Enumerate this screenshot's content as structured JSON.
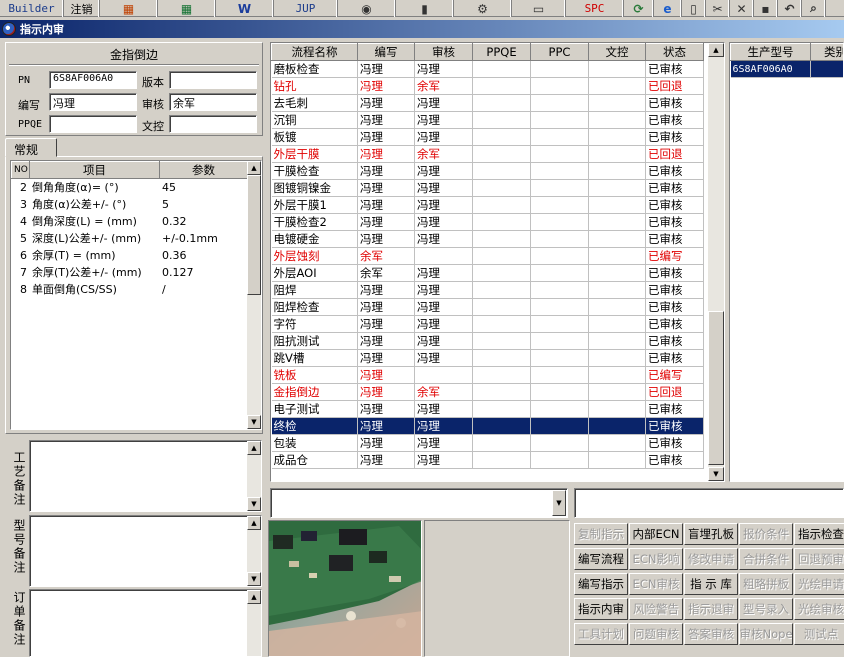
{
  "toolbar": {
    "items": [
      {
        "label": "Builder",
        "icon": ""
      },
      {
        "label": "注销",
        "icon": ""
      },
      {
        "label": "",
        "icon": "x-icon"
      },
      {
        "label": "",
        "icon": "excel-icon"
      },
      {
        "label": "",
        "icon": "word-icon"
      },
      {
        "label": "JUP",
        "icon": ""
      },
      {
        "label": "",
        "icon": "eye-icon"
      },
      {
        "label": "",
        "icon": "database-icon"
      },
      {
        "label": "",
        "icon": "network-icon"
      },
      {
        "label": "",
        "icon": "computer-icon"
      },
      {
        "label": "SPC",
        "icon": ""
      },
      {
        "label": "",
        "icon": "refresh-icon"
      },
      {
        "label": "",
        "icon": "ie-icon"
      },
      {
        "label": "",
        "icon": "new-icon"
      },
      {
        "label": "",
        "icon": "scissors-icon"
      },
      {
        "label": "",
        "icon": "close-icon"
      },
      {
        "label": "",
        "icon": "save-icon"
      },
      {
        "label": "",
        "icon": "undo-icon"
      },
      {
        "label": "",
        "icon": "search-icon"
      }
    ]
  },
  "window": {
    "title": "指示内审"
  },
  "info": {
    "group_title": "金指倒边",
    "pn_label": "PN",
    "pn_value": "6S8AF006A0",
    "version_label": "版本",
    "version_value": "",
    "author_label": "编写",
    "author_value": "冯理",
    "reviewer_label": "审核",
    "reviewer_value": "余军",
    "ppqe_label": "PPQE",
    "ppqe_value": "",
    "control_label": "文控",
    "control_value": ""
  },
  "tabs": {
    "general": "常规"
  },
  "params": {
    "headers": [
      "NO",
      "项目",
      "参数"
    ],
    "rows": [
      {
        "no": "2",
        "item": "倒角角度(α)=  (°)",
        "value": "45"
      },
      {
        "no": "3",
        "item": "角度(α)公差+/-  (°)",
        "value": "5"
      },
      {
        "no": "4",
        "item": "倒角深度(L) =  (mm)",
        "value": "0.32"
      },
      {
        "no": "5",
        "item": "深度(L)公差+/-  (mm)",
        "value": "+/-0.1mm"
      },
      {
        "no": "6",
        "item": "余厚(T) =  (mm)",
        "value": "0.36"
      },
      {
        "no": "7",
        "item": "余厚(T)公差+/-  (mm)",
        "value": "0.127"
      },
      {
        "no": "8",
        "item": "单面倒角(CS/SS)",
        "value": "/"
      }
    ]
  },
  "notes": {
    "process": "工艺备注",
    "model": "型号备注",
    "order": "订单备注"
  },
  "flow": {
    "headers": [
      "流程名称",
      "编写",
      "审核",
      "PPQE",
      "PPC",
      "文控",
      "状态"
    ],
    "rows": [
      {
        "name": "磨板检查",
        "author": "冯理",
        "reviewer": "冯理",
        "ppqe": "",
        "ppc": "",
        "ctrl": "",
        "status": "已审核",
        "state": "ok"
      },
      {
        "name": "钻孔",
        "author": "冯理",
        "reviewer": "余军",
        "ppqe": "",
        "ppc": "",
        "ctrl": "",
        "status": "已回退",
        "state": "red"
      },
      {
        "name": "去毛刺",
        "author": "冯理",
        "reviewer": "冯理",
        "ppqe": "",
        "ppc": "",
        "ctrl": "",
        "status": "已审核",
        "state": "ok"
      },
      {
        "name": "沉铜",
        "author": "冯理",
        "reviewer": "冯理",
        "ppqe": "",
        "ppc": "",
        "ctrl": "",
        "status": "已审核",
        "state": "ok"
      },
      {
        "name": "板镀",
        "author": "冯理",
        "reviewer": "冯理",
        "ppqe": "",
        "ppc": "",
        "ctrl": "",
        "status": "已审核",
        "state": "ok"
      },
      {
        "name": "外层干膜",
        "author": "冯理",
        "reviewer": "余军",
        "ppqe": "",
        "ppc": "",
        "ctrl": "",
        "status": "已回退",
        "state": "red"
      },
      {
        "name": "干膜检查",
        "author": "冯理",
        "reviewer": "冯理",
        "ppqe": "",
        "ppc": "",
        "ctrl": "",
        "status": "已审核",
        "state": "ok"
      },
      {
        "name": "图镀铜镍金",
        "author": "冯理",
        "reviewer": "冯理",
        "ppqe": "",
        "ppc": "",
        "ctrl": "",
        "status": "已审核",
        "state": "ok"
      },
      {
        "name": "外层干膜1",
        "author": "冯理",
        "reviewer": "冯理",
        "ppqe": "",
        "ppc": "",
        "ctrl": "",
        "status": "已审核",
        "state": "ok"
      },
      {
        "name": "干膜检查2",
        "author": "冯理",
        "reviewer": "冯理",
        "ppqe": "",
        "ppc": "",
        "ctrl": "",
        "status": "已审核",
        "state": "ok"
      },
      {
        "name": "电镀硬金",
        "author": "冯理",
        "reviewer": "冯理",
        "ppqe": "",
        "ppc": "",
        "ctrl": "",
        "status": "已审核",
        "state": "ok"
      },
      {
        "name": "外层蚀刻",
        "author": "余军",
        "reviewer": "",
        "ppqe": "",
        "ppc": "",
        "ctrl": "",
        "status": "已编写",
        "state": "red"
      },
      {
        "name": "外层AOI",
        "author": "余军",
        "reviewer": "冯理",
        "ppqe": "",
        "ppc": "",
        "ctrl": "",
        "status": "已审核",
        "state": "ok"
      },
      {
        "name": "阻焊",
        "author": "冯理",
        "reviewer": "冯理",
        "ppqe": "",
        "ppc": "",
        "ctrl": "",
        "status": "已审核",
        "state": "ok"
      },
      {
        "name": "阻焊检查",
        "author": "冯理",
        "reviewer": "冯理",
        "ppqe": "",
        "ppc": "",
        "ctrl": "",
        "status": "已审核",
        "state": "ok"
      },
      {
        "name": "字符",
        "author": "冯理",
        "reviewer": "冯理",
        "ppqe": "",
        "ppc": "",
        "ctrl": "",
        "status": "已审核",
        "state": "ok"
      },
      {
        "name": "阻抗测试",
        "author": "冯理",
        "reviewer": "冯理",
        "ppqe": "",
        "ppc": "",
        "ctrl": "",
        "status": "已审核",
        "state": "ok"
      },
      {
        "name": "跳V槽",
        "author": "冯理",
        "reviewer": "冯理",
        "ppqe": "",
        "ppc": "",
        "ctrl": "",
        "status": "已审核",
        "state": "ok"
      },
      {
        "name": "铣板",
        "author": "冯理",
        "reviewer": "",
        "ppqe": "",
        "ppc": "",
        "ctrl": "",
        "status": "已编写",
        "state": "red"
      },
      {
        "name": "金指倒边",
        "author": "冯理",
        "reviewer": "余军",
        "ppqe": "",
        "ppc": "",
        "ctrl": "",
        "status": "已回退",
        "state": "red"
      },
      {
        "name": "电子测试",
        "author": "冯理",
        "reviewer": "冯理",
        "ppqe": "",
        "ppc": "",
        "ctrl": "",
        "status": "已审核",
        "state": "ok"
      },
      {
        "name": "终检",
        "author": "冯理",
        "reviewer": "冯理",
        "ppqe": "",
        "ppc": "",
        "ctrl": "",
        "status": "已审核",
        "state": "sel"
      },
      {
        "name": "包装",
        "author": "冯理",
        "reviewer": "冯理",
        "ppqe": "",
        "ppc": "",
        "ctrl": "",
        "status": "已审核",
        "state": "ok"
      },
      {
        "name": "成品仓",
        "author": "冯理",
        "reviewer": "冯理",
        "ppqe": "",
        "ppc": "",
        "ctrl": "",
        "status": "已审核",
        "state": "ok"
      }
    ]
  },
  "models": {
    "headers": [
      "生产型号",
      "类别"
    ],
    "rows": [
      {
        "model": "6S8AF006A0",
        "category": ""
      }
    ]
  },
  "combo": {
    "left_value": "",
    "right_value": ""
  },
  "actions": [
    [
      {
        "label": "复制指示",
        "enabled": false
      },
      {
        "label": "内部ECN",
        "enabled": true
      },
      {
        "label": "盲埋孔板",
        "enabled": true
      },
      {
        "label": "报价条件",
        "enabled": false
      },
      {
        "label": "指示检查",
        "enabled": true
      }
    ],
    [
      {
        "label": "编写流程",
        "enabled": true
      },
      {
        "label": "ECN影响",
        "enabled": false
      },
      {
        "label": "修改申请",
        "enabled": false
      },
      {
        "label": "合拼条件",
        "enabled": false
      },
      {
        "label": "回退预审",
        "enabled": false
      }
    ],
    [
      {
        "label": "编写指示",
        "enabled": true
      },
      {
        "label": "ECN审核",
        "enabled": false
      },
      {
        "label": "指 示 库",
        "enabled": true
      },
      {
        "label": "粗略拼板",
        "enabled": false
      },
      {
        "label": "光绘申请",
        "enabled": false
      }
    ],
    [
      {
        "label": "指示内审",
        "enabled": true
      },
      {
        "label": "风险警告",
        "enabled": false
      },
      {
        "label": "指示退审",
        "enabled": false
      },
      {
        "label": "型号录入",
        "enabled": false
      },
      {
        "label": "光绘审核",
        "enabled": false
      }
    ],
    [
      {
        "label": "工具计划",
        "enabled": false
      },
      {
        "label": "问题审核",
        "enabled": false
      },
      {
        "label": "答案审核",
        "enabled": false
      },
      {
        "label": "审核Nope",
        "enabled": false
      },
      {
        "label": "测试点",
        "enabled": false
      }
    ]
  ],
  "colors": {
    "title_start": "#0a246a",
    "title_end": "#a6caf0",
    "selection": "#0a246a",
    "alert_red": "#e00000"
  }
}
